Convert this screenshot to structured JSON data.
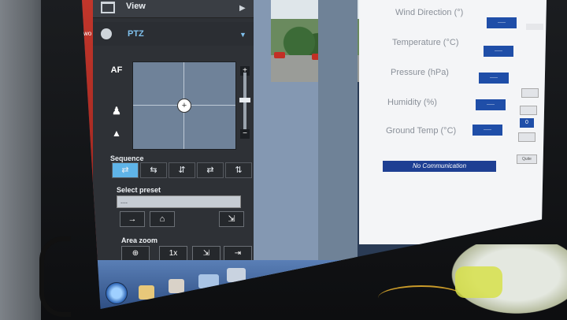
{
  "desktop": {
    "label": "wo"
  },
  "camera_panel": {
    "view_label": "View",
    "ptz_label": "PTZ",
    "af_label": "AF",
    "zoom_plus": "+",
    "zoom_minus": "−",
    "sequence_label": "Sequence",
    "sequence_buttons": [
      "⇄",
      "⇆",
      "⇵",
      "⇄",
      "⇅"
    ],
    "preset_label": "Select preset",
    "preset_value": "---",
    "preset_buttons": [
      "→",
      "⌂",
      "⇲"
    ],
    "area_zoom_label": "Area zoom",
    "area_buttons": [
      "⊕",
      "1x",
      "⇲",
      "⇥"
    ]
  },
  "weather": {
    "fields": [
      {
        "label": "Wind Direction (°)",
        "value": "-----"
      },
      {
        "label": "Temperature (°C)",
        "value": "-----"
      },
      {
        "label": "Pressure (hPa)",
        "value": "-----"
      },
      {
        "label": "Humidity (%)",
        "value": "-----"
      },
      {
        "label": "Ground Temp (°C)",
        "value": "-----"
      }
    ],
    "status": "No Communication",
    "side_value": "0",
    "quit_label": "Quite"
  },
  "colors": {
    "status_blue": "#1e3f93",
    "panel_dark": "#2e3136",
    "video_blue": "#8498b2"
  }
}
